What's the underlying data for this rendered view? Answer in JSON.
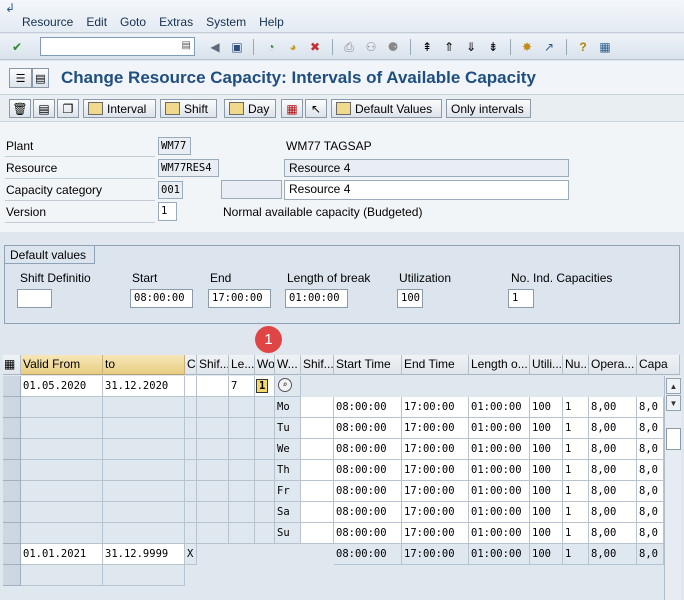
{
  "menubar": {
    "items": [
      "Resource",
      "Edit",
      "Goto",
      "Extras",
      "System",
      "Help"
    ]
  },
  "title": "Change Resource Capacity: Intervals of Available Capacity",
  "app_toolbar": {
    "interval": "Interval",
    "shift": "Shift",
    "day": "Day",
    "default_values": "Default Values",
    "only_intervals": "Only intervals"
  },
  "header": {
    "plant_label": "Plant",
    "plant_value": "WM77",
    "plant_desc": "WM77 TAGSAP",
    "resource_label": "Resource",
    "resource_value": "WM77RES4",
    "resource_desc": "Resource 4",
    "capcat_label": "Capacity category",
    "capcat_value": "001",
    "capcat_desc": "Resource 4",
    "version_label": "Version",
    "version_value": "1",
    "version_desc": "Normal available capacity (Budgeted)"
  },
  "defaults": {
    "title": "Default values",
    "shift_label": "Shift Definitio",
    "shift_value": "",
    "start_label": "Start",
    "start_value": "08:00:00",
    "end_label": "End",
    "end_value": "17:00:00",
    "break_label": "Length of break",
    "break_value": "01:00:00",
    "util_label": "Utilization",
    "util_value": "100",
    "noind_label": "No. Ind. Capacities",
    "noind_value": "1"
  },
  "annotation": "1",
  "table": {
    "headers": [
      "Valid From",
      "to",
      "C",
      "Shif...",
      "Le...",
      "Wo",
      "W...",
      "Shif...",
      "Start Time",
      "End Time",
      "Length o...",
      "Utili...",
      "Nu...",
      "Opera...",
      "Capa"
    ],
    "interval1": {
      "from": "01.05.2020",
      "to": "31.12.2020",
      "length": "7",
      "workdays": "1"
    },
    "days": [
      {
        "day": "Mo",
        "start": "08:00:00",
        "end": "17:00:00",
        "brk": "01:00:00",
        "util": "100",
        "num": "1",
        "op": "8,00",
        "cap": "8,0"
      },
      {
        "day": "Tu",
        "start": "08:00:00",
        "end": "17:00:00",
        "brk": "01:00:00",
        "util": "100",
        "num": "1",
        "op": "8,00",
        "cap": "8,0"
      },
      {
        "day": "We",
        "start": "08:00:00",
        "end": "17:00:00",
        "brk": "01:00:00",
        "util": "100",
        "num": "1",
        "op": "8,00",
        "cap": "8,0"
      },
      {
        "day": "Th",
        "start": "08:00:00",
        "end": "17:00:00",
        "brk": "01:00:00",
        "util": "100",
        "num": "1",
        "op": "8,00",
        "cap": "8,0"
      },
      {
        "day": "Fr",
        "start": "08:00:00",
        "end": "17:00:00",
        "brk": "01:00:00",
        "util": "100",
        "num": "1",
        "op": "8,00",
        "cap": "8,0"
      },
      {
        "day": "Sa",
        "start": "08:00:00",
        "end": "17:00:00",
        "brk": "01:00:00",
        "util": "100",
        "num": "1",
        "op": "8,00",
        "cap": "8,0"
      },
      {
        "day": "Su",
        "start": "08:00:00",
        "end": "17:00:00",
        "brk": "01:00:00",
        "util": "100",
        "num": "1",
        "op": "8,00",
        "cap": "8,0"
      }
    ],
    "interval2": {
      "from": "01.01.2021",
      "to": "31.12.9999",
      "c": "X",
      "start": "08:00:00",
      "end": "17:00:00",
      "brk": "01:00:00",
      "util": "100",
      "num": "1",
      "op": "8,00",
      "cap": "8,0"
    }
  }
}
